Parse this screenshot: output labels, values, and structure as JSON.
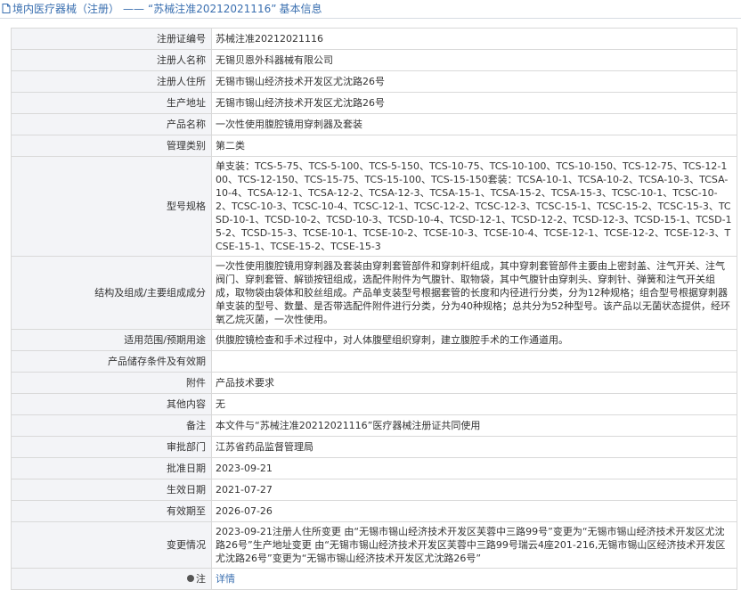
{
  "header": {
    "prefix": "境内医疗器械（注册）",
    "separator": "——",
    "number_quoted": "“苏械注准20212021116”",
    "suffix": "基本信息"
  },
  "rows": [
    {
      "key": "注册证编号",
      "value": "苏械注准20212021116"
    },
    {
      "key": "注册人名称",
      "value": "无锡贝恩外科器械有限公司"
    },
    {
      "key": "注册人住所",
      "value": "无锡市锡山经济技术开发区尤沈路26号"
    },
    {
      "key": "生产地址",
      "value": "无锡市锡山经济技术开发区尤沈路26号"
    },
    {
      "key": "产品名称",
      "value": "一次性使用腹腔镜用穿刺器及套装"
    },
    {
      "key": "管理类别",
      "value": "第二类"
    },
    {
      "key": "型号规格",
      "value": "单支装：TCS-5-75、TCS-5-100、TCS-5-150、TCS-10-75、TCS-10-100、TCS-10-150、TCS-12-75、TCS-12-100、TCS-12-150、TCS-15-75、TCS-15-100、TCS-15-150套装：TCSA-10-1、TCSA-10-2、TCSA-10-3、TCSA-10-4、TCSA-12-1、TCSA-12-2、TCSA-12-3、TCSA-15-1、TCSA-15-2、TCSA-15-3、TCSC-10-1、TCSC-10-2、TCSC-10-3、TCSC-10-4、TCSC-12-1、TCSC-12-2、TCSC-12-3、TCSC-15-1、TCSC-15-2、TCSC-15-3、TCSD-10-1、TCSD-10-2、TCSD-10-3、TCSD-10-4、TCSD-12-1、TCSD-12-2、TCSD-12-3、TCSD-15-1、TCSD-15-2、TCSD-15-3、TCSE-10-1、TCSE-10-2、TCSE-10-3、TCSE-10-4、TCSE-12-1、TCSE-12-2、TCSE-12-3、TCSE-15-1、TCSE-15-2、TCSE-15-3"
    },
    {
      "key": "结构及组成/主要组成成分",
      "value": "一次性使用腹腔镜用穿刺器及套装由穿刺套管部件和穿刺杆组成，其中穿刺套管部件主要由上密封盖、注气开关、注气阀门、穿刺套管、解锁按钮组成，选配件附件为气腹针、取物袋，其中气腹针由穿刺头、穿刺针、弹簧和注气开关组成，取物袋由袋体和胶丝组成。产品单支装型号根据套管的长度和内径进行分类，分为12种规格；组合型号根据穿刺器单支装的型号、数量、是否带选配件附件进行分类，分为40种规格；总共分为52种型号。该产品以无菌状态提供，经环氧乙烷灭菌，一次性使用。"
    },
    {
      "key": "适用范围/预期用途",
      "value": "供腹腔镜检查和手术过程中，对人体腹壁组织穿刺，建立腹腔手术的工作通道用。"
    },
    {
      "key": "产品储存条件及有效期",
      "value": ""
    },
    {
      "key": "附件",
      "value": "产品技术要求"
    },
    {
      "key": "其他内容",
      "value": "无"
    },
    {
      "key": "备注",
      "value": "本文件与“苏械注准20212021116”医疗器械注册证共同使用"
    },
    {
      "key": "审批部门",
      "value": "江苏省药品监督管理局"
    },
    {
      "key": "批准日期",
      "value": "2023-09-21"
    },
    {
      "key": "生效日期",
      "value": "2021-07-27"
    },
    {
      "key": "有效期至",
      "value": "2026-07-26"
    },
    {
      "key": "变更情况",
      "value": "2023-09-21注册人住所变更 由“无锡市锡山经济技术开发区芙蓉中三路99号”变更为“无锡市锡山经济技术开发区尤沈路26号”生产地址变更 由“无锡市锡山经济技术开发区芙蓉中三路99号瑞云4座201-216,无锡市锡山区经济技术开发区尤沈路26号”变更为“无锡市锡山经济技术开发区尤沈路26号”"
    }
  ],
  "note_row": {
    "key": "注",
    "link": "详情"
  }
}
